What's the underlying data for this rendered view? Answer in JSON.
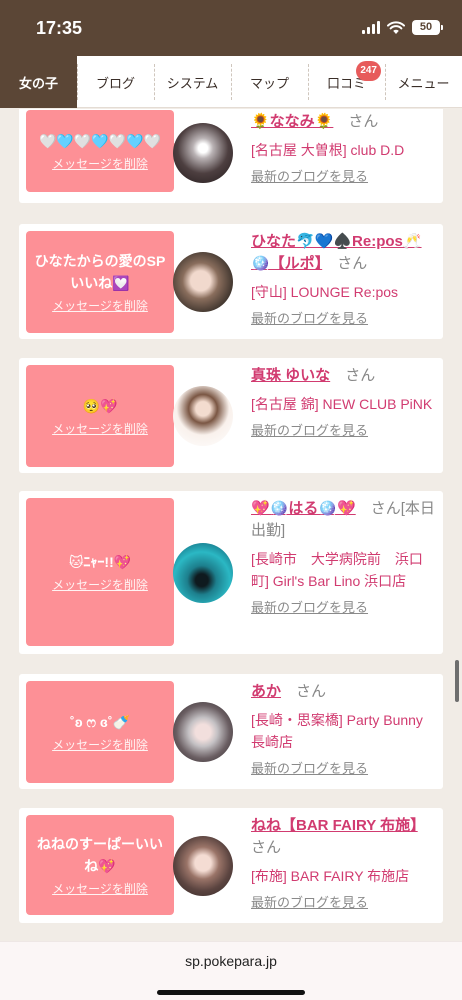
{
  "status_bar": {
    "time": "17:35",
    "battery": "50"
  },
  "tabs": [
    {
      "label": "女の子",
      "active": true
    },
    {
      "label": "ブログ",
      "active": false
    },
    {
      "label": "システム",
      "active": false
    },
    {
      "label": "マップ",
      "active": false
    },
    {
      "label": "口コミ",
      "active": false,
      "badge": "247"
    },
    {
      "label": "メニュー",
      "active": false
    }
  ],
  "common": {
    "delete_label": "メッセージを削除",
    "blog_label": "最新のブログを見る",
    "san": "さん"
  },
  "cards": [
    {
      "message": "🤍🩵🤍🩵🤍🩵🤍",
      "name": "🌻ななみ🌻",
      "san_suffix": "",
      "shop": "[名古屋 大曽根] club D.D"
    },
    {
      "message": "ひなたからの愛のSPいいね💟",
      "name": "ひなた🐬💙♠️Re:pos🥂🪩【ルポ】",
      "san_suffix": "",
      "shop": "[守山] LOUNGE Re:pos"
    },
    {
      "message": "🥺💖",
      "name": "真珠 ゆいな",
      "san_suffix": "",
      "shop": "[名古屋 錦] NEW CLUB PiNK"
    },
    {
      "message": "🐱ﾆｬｰ!!💖",
      "name": "💖🪩はる🪩💖",
      "san_suffix": "[本日出勤]",
      "shop": "[長崎市　大学病院前　浜口町] Girl's Bar Lino 浜口店"
    },
    {
      "message": "˚ʚ ෆ ɞ˚🍼",
      "name": "あか",
      "san_suffix": "",
      "shop": "[長崎・思案橋] Party Bunny 長崎店"
    },
    {
      "message": "ねねのすーぱーいいね💖",
      "name": "ねね【BAR FAIRY 布施】",
      "san_suffix": "",
      "shop": "[布施] BAR FAIRY 布施店"
    }
  ],
  "browser": {
    "url": "sp.pokepara.jp"
  }
}
